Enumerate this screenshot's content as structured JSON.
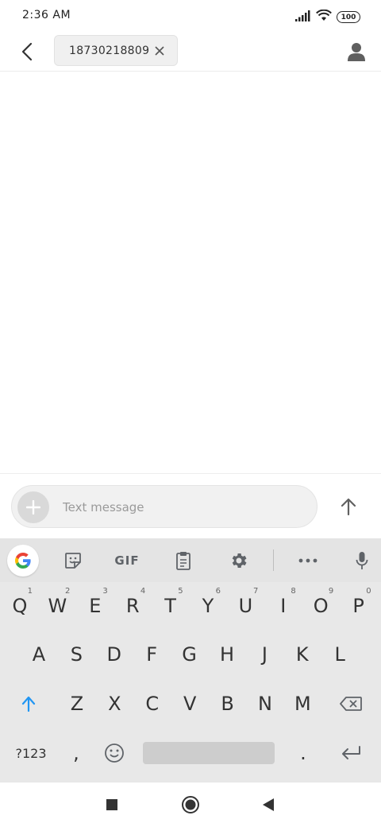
{
  "status_bar": {
    "time": "2:36 AM",
    "battery": "100"
  },
  "header": {
    "recipient": "18730218809"
  },
  "compose": {
    "placeholder": "Text message"
  },
  "toolbar": {
    "gif_label": "GIF"
  },
  "keyboard": {
    "row1": [
      "Q",
      "W",
      "E",
      "R",
      "T",
      "Y",
      "U",
      "I",
      "O",
      "P"
    ],
    "row1_hints": [
      "1",
      "2",
      "3",
      "4",
      "5",
      "6",
      "7",
      "8",
      "9",
      "0"
    ],
    "row2": [
      "A",
      "S",
      "D",
      "F",
      "G",
      "H",
      "J",
      "K",
      "L"
    ],
    "row3": [
      "Z",
      "X",
      "C",
      "V",
      "B",
      "N",
      "M"
    ],
    "symbols_label": "?123",
    "comma": ",",
    "period": "."
  },
  "colors": {
    "accent": "#2196f3",
    "icon_gray": "#616161"
  }
}
